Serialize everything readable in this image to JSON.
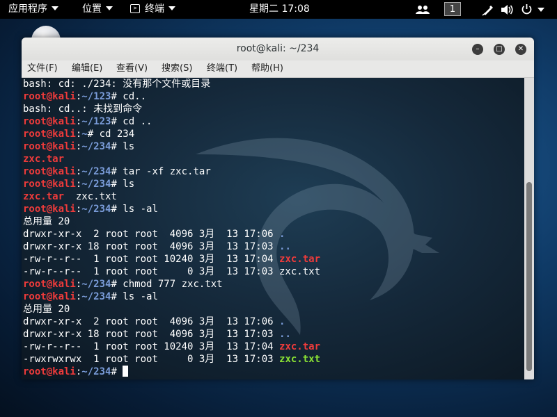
{
  "topbar": {
    "apps_label": "应用程序",
    "places_label": "位置",
    "terminal_label": "终端",
    "clock": "星期二 17:08",
    "workspace": "1"
  },
  "window": {
    "title": "root@kali: ~/234",
    "menu": [
      "文件(F)",
      "编辑(E)",
      "查看(V)",
      "搜索(S)",
      "终端(T)",
      "帮助(H)"
    ]
  },
  "terminal": {
    "lines": [
      [
        {
          "t": "bash: cd: ./234: 没有那个文件或目录",
          "c": "normal"
        }
      ],
      [
        {
          "t": "root@kali",
          "c": "prompt-user"
        },
        {
          "t": ":",
          "c": "sep"
        },
        {
          "t": "~/123",
          "c": "path"
        },
        {
          "t": "# cd..",
          "c": "normal"
        }
      ],
      [
        {
          "t": "bash: cd..: 未找到命令",
          "c": "normal"
        }
      ],
      [
        {
          "t": "root@kali",
          "c": "prompt-user"
        },
        {
          "t": ":",
          "c": "sep"
        },
        {
          "t": "~/123",
          "c": "path"
        },
        {
          "t": "# cd ..",
          "c": "normal"
        }
      ],
      [
        {
          "t": "root@kali",
          "c": "prompt-user"
        },
        {
          "t": ":",
          "c": "sep"
        },
        {
          "t": "~",
          "c": "path"
        },
        {
          "t": "# cd 234",
          "c": "normal"
        }
      ],
      [
        {
          "t": "root@kali",
          "c": "prompt-user"
        },
        {
          "t": ":",
          "c": "sep"
        },
        {
          "t": "~/234",
          "c": "path"
        },
        {
          "t": "# ls",
          "c": "normal"
        }
      ],
      [
        {
          "t": "zxc.tar",
          "c": "red"
        }
      ],
      [
        {
          "t": "root@kali",
          "c": "prompt-user"
        },
        {
          "t": ":",
          "c": "sep"
        },
        {
          "t": "~/234",
          "c": "path"
        },
        {
          "t": "# tar -xf zxc.tar",
          "c": "normal"
        }
      ],
      [
        {
          "t": "root@kali",
          "c": "prompt-user"
        },
        {
          "t": ":",
          "c": "sep"
        },
        {
          "t": "~/234",
          "c": "path"
        },
        {
          "t": "# ls",
          "c": "normal"
        }
      ],
      [
        {
          "t": "zxc.tar",
          "c": "red"
        },
        {
          "t": "  zxc.txt",
          "c": "normal"
        }
      ],
      [
        {
          "t": "root@kali",
          "c": "prompt-user"
        },
        {
          "t": ":",
          "c": "sep"
        },
        {
          "t": "~/234",
          "c": "path"
        },
        {
          "t": "# ls -al",
          "c": "normal"
        }
      ],
      [
        {
          "t": "总用量 20",
          "c": "normal"
        }
      ],
      [
        {
          "t": "drwxr-xr-x  2 root root  4096 3月  13 17:06 ",
          "c": "normal"
        },
        {
          "t": ".",
          "c": "blue"
        }
      ],
      [
        {
          "t": "drwxr-xr-x 18 root root  4096 3月  13 17:03 ",
          "c": "normal"
        },
        {
          "t": "..",
          "c": "blue"
        }
      ],
      [
        {
          "t": "-rw-r--r--  1 root root 10240 3月  13 17:04 ",
          "c": "normal"
        },
        {
          "t": "zxc.tar",
          "c": "red"
        }
      ],
      [
        {
          "t": "-rw-r--r--  1 root root     0 3月  13 17:03 zxc.txt",
          "c": "normal"
        }
      ],
      [
        {
          "t": "root@kali",
          "c": "prompt-user"
        },
        {
          "t": ":",
          "c": "sep"
        },
        {
          "t": "~/234",
          "c": "path"
        },
        {
          "t": "# chmod 777 zxc.txt",
          "c": "normal"
        }
      ],
      [
        {
          "t": "root@kali",
          "c": "prompt-user"
        },
        {
          "t": ":",
          "c": "sep"
        },
        {
          "t": "~/234",
          "c": "path"
        },
        {
          "t": "# ls -al",
          "c": "normal"
        }
      ],
      [
        {
          "t": "总用量 20",
          "c": "normal"
        }
      ],
      [
        {
          "t": "drwxr-xr-x  2 root root  4096 3月  13 17:06 ",
          "c": "normal"
        },
        {
          "t": ".",
          "c": "blue"
        }
      ],
      [
        {
          "t": "drwxr-xr-x 18 root root  4096 3月  13 17:03 ",
          "c": "normal"
        },
        {
          "t": "..",
          "c": "blue"
        }
      ],
      [
        {
          "t": "-rw-r--r--  1 root root 10240 3月  13 17:04 ",
          "c": "normal"
        },
        {
          "t": "zxc.tar",
          "c": "red"
        }
      ],
      [
        {
          "t": "-rwxrwxrwx  1 root root     0 3月  13 17:03 ",
          "c": "normal"
        },
        {
          "t": "zxc.txt",
          "c": "green"
        }
      ],
      [
        {
          "t": "root@kali",
          "c": "prompt-user"
        },
        {
          "t": ":",
          "c": "sep"
        },
        {
          "t": "~/234",
          "c": "path"
        },
        {
          "t": "# ",
          "c": "normal"
        }
      ]
    ]
  },
  "colors": {
    "prompt_user": "#ef3b3b",
    "path": "#7a9cd9",
    "executable": "#8ae234",
    "archive": "#ef3b3b"
  },
  "icons": [
    "chevron-down-icon",
    "terminal-icon",
    "people-icon",
    "pen-icon",
    "volume-icon",
    "power-icon",
    "minimize-icon",
    "maximize-icon",
    "close-icon"
  ]
}
